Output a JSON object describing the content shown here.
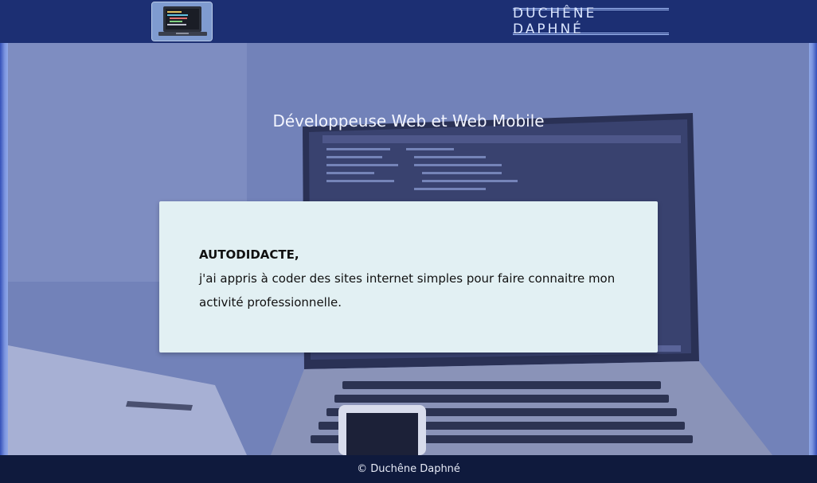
{
  "header": {
    "logo_alt": "laptop-code-icon",
    "brand": "DUCHÊNE DAPHNÉ"
  },
  "hero": {
    "title": "Développeuse Web et Web Mobile",
    "card": {
      "heading": "AUTODIDACTE,",
      "text": "j'ai appris à coder des sites internet simples pour faire connaitre mon activité professionnelle."
    }
  },
  "footer": {
    "copyright": "© Duchêne Daphné"
  },
  "colors": {
    "header_bg": "#1c2f73",
    "footer_bg": "#0f1a3d",
    "card_bg": "#e2f0f3",
    "brand_text": "#dbe6ff"
  }
}
